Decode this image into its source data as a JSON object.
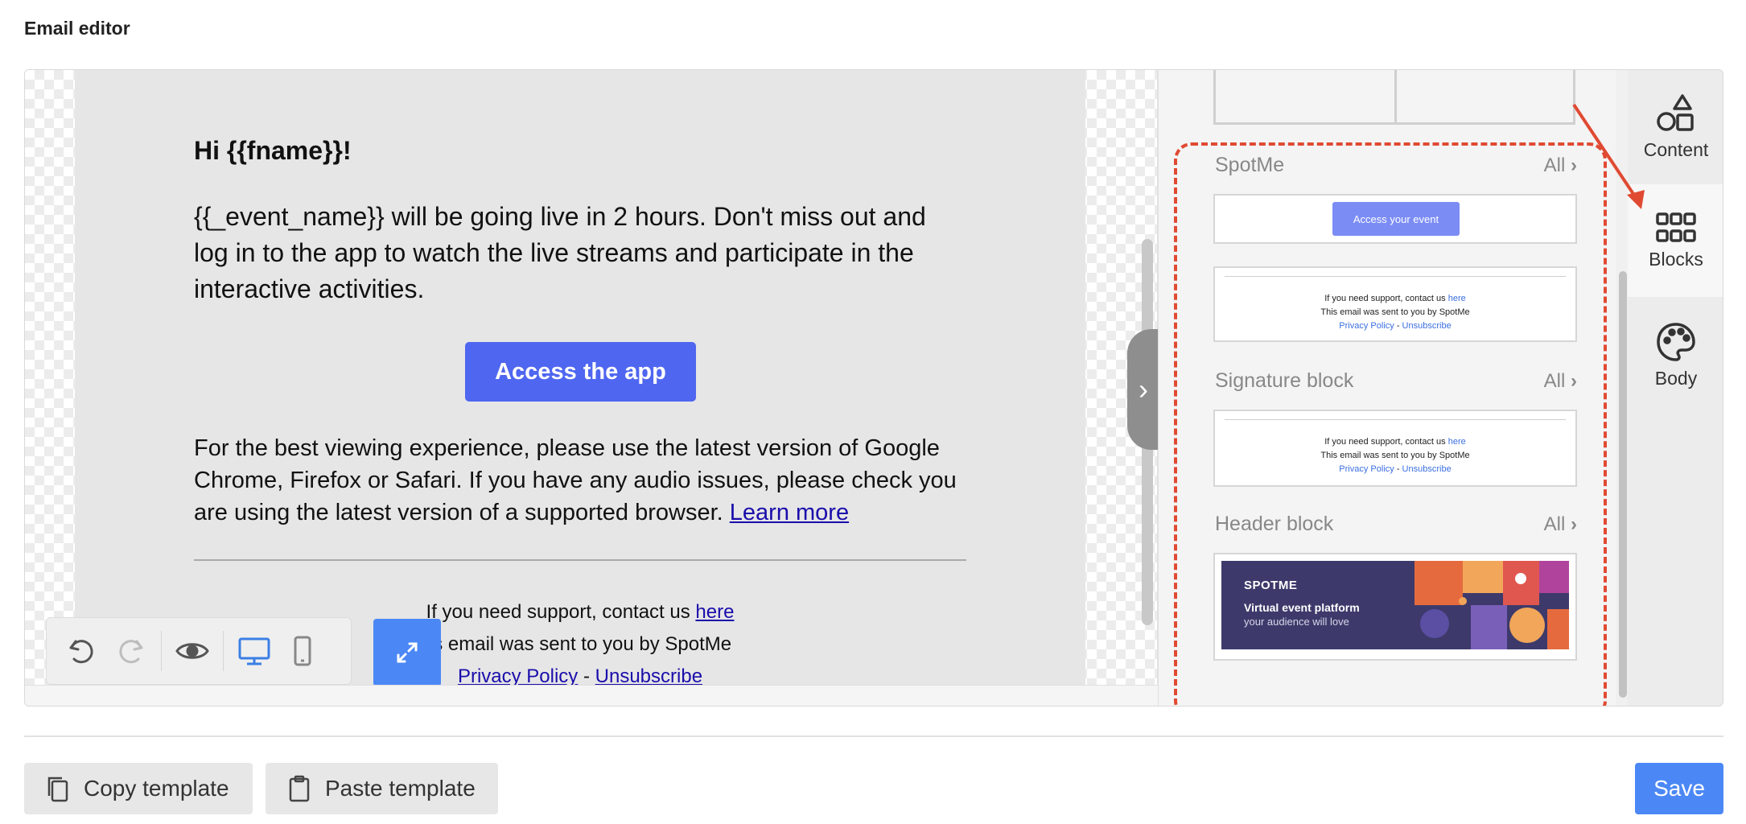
{
  "page": {
    "title": "Email editor"
  },
  "email": {
    "greeting": "Hi {{fname}}!",
    "paragraph1": "{{_event_name}} will be going live in 2 hours. Don't miss out and log in to the app to watch the live streams and participate in the interactive activities.",
    "cta_label": "Access the app",
    "paragraph2": "For the best viewing experience, please use the latest version of Google Chrome, Firefox or Safari. If you have any audio issues, please check you are using the latest version of a supported browser.",
    "learn_more": "Learn more",
    "support_text": "If you need support, contact us",
    "support_link": "here",
    "sent_by": "is email was sent to you by SpotMe",
    "privacy": "Privacy Policy",
    "dash": " - ",
    "unsubscribe": "Unsubscribe"
  },
  "blocks_panel": {
    "sections": [
      {
        "title": "SpotMe",
        "all_label": "All"
      },
      {
        "title": "Signature block",
        "all_label": "All"
      },
      {
        "title": "Header block",
        "all_label": "All"
      }
    ],
    "spotme_button": "Access your event",
    "mini_footer": {
      "support": "If you need support, contact us",
      "here": "here",
      "sent_by": "This email was sent to you by SpotMe",
      "privacy": "Privacy Policy",
      "sep": " - ",
      "unsubscribe": "Unsubscribe"
    },
    "header_banner": {
      "brand": "SPOTME",
      "headline": "Virtual event platform",
      "sub": "your audience will love"
    }
  },
  "tabs": {
    "content": "Content",
    "blocks": "Blocks",
    "body": "Body"
  },
  "toolbar": {
    "undo": "undo-icon",
    "redo": "redo-icon",
    "preview": "eye-icon",
    "desktop": "desktop-icon",
    "mobile": "mobile-icon",
    "expand": "expand-icon"
  },
  "actions": {
    "copy": "Copy template",
    "paste": "Paste template",
    "save": "Save"
  },
  "colors": {
    "accent": "#4b88f5",
    "cta": "#4f66f0",
    "highlight": "#e04a33"
  }
}
